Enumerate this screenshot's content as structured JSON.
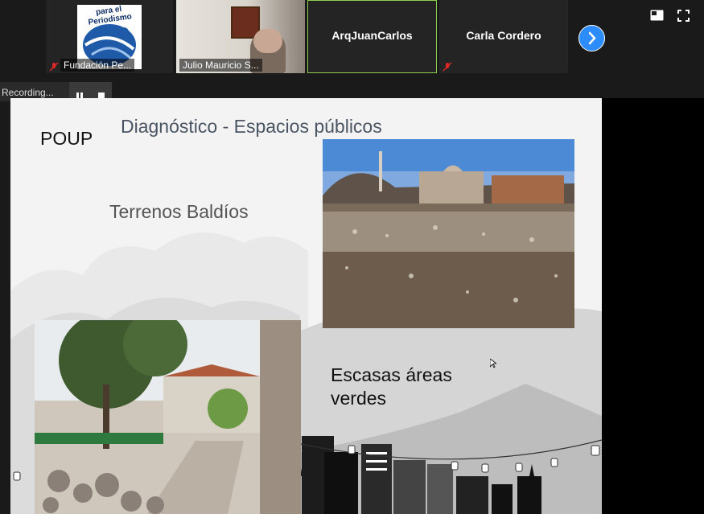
{
  "participants": [
    {
      "name": "Fundación Pe...",
      "muted": true
    },
    {
      "name": "Julio Mauricio S...",
      "muted": false
    },
    {
      "name": "ArqJuanCarlos",
      "muted": false,
      "active": true
    },
    {
      "name": "Carla Cordero",
      "muted": true
    }
  ],
  "logo_text": "para el Periodismo",
  "recording": {
    "label": "Recording..."
  },
  "slide": {
    "poup": "POUP",
    "title": "Diagnóstico - Espacios públicos",
    "subtitle": "Terrenos  Baldíos",
    "text2": "Escasas áreas\nverdes"
  },
  "colors": {
    "accent": "#2d8cff",
    "active_border": "#8fd14f",
    "muted_red": "#e02828"
  }
}
